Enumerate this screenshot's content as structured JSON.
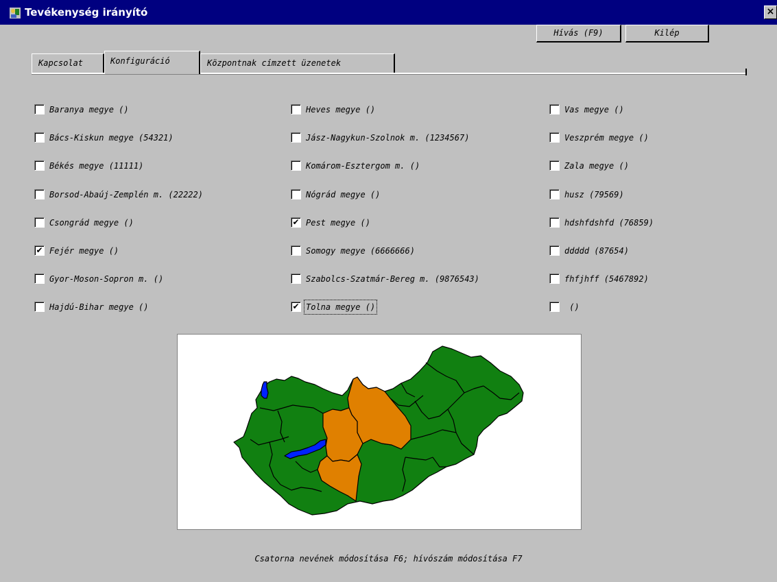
{
  "window": {
    "title": "Tevékenység irányító",
    "close_glyph": "×"
  },
  "buttons": {
    "call": "Hívás (F9)",
    "exit": "Kilép"
  },
  "tabs": [
    {
      "label": "Kapcsolat",
      "active": false
    },
    {
      "label": "Konfiguráció",
      "active": true
    },
    {
      "label": "Központnak címzett üzenetek",
      "active": false
    }
  ],
  "checkmark_glyph": "✔",
  "checkbox_columns": [
    [
      {
        "label": "Baranya megye ()",
        "checked": false
      },
      {
        "label": "Bács-Kiskun megye (54321)",
        "checked": false
      },
      {
        "label": "Békés megye (11111)",
        "checked": false
      },
      {
        "label": "Borsod-Abaúj-Zemplén m. (22222)",
        "checked": false
      },
      {
        "label": "Csongrád megye ()",
        "checked": false
      },
      {
        "label": "Fejér megye ()",
        "checked": true
      },
      {
        "label": "Gyor-Moson-Sopron m. ()",
        "checked": false
      },
      {
        "label": "Hajdú-Bihar megye ()",
        "checked": false
      }
    ],
    [
      {
        "label": "Heves megye ()",
        "checked": false
      },
      {
        "label": "Jász-Nagykun-Szolnok m. (1234567)",
        "checked": false
      },
      {
        "label": "Komárom-Esztergom m. ()",
        "checked": false
      },
      {
        "label": "Nógrád megye ()",
        "checked": false
      },
      {
        "label": "Pest megye ()",
        "checked": true
      },
      {
        "label": "Somogy megye (6666666)",
        "checked": false
      },
      {
        "label": "Szabolcs-Szatmár-Bereg m. (9876543)",
        "checked": false
      },
      {
        "label": "Tolna megye ()",
        "checked": true,
        "focused": true
      }
    ],
    [
      {
        "label": "Vas megye ()",
        "checked": false
      },
      {
        "label": "Veszprém megye ()",
        "checked": false
      },
      {
        "label": "Zala megye ()",
        "checked": false
      },
      {
        "label": "husz (79569)",
        "checked": false
      },
      {
        "label": "hdshfdshfd (76859)",
        "checked": false
      },
      {
        "label": "ddddd (87654)",
        "checked": false
      },
      {
        "label": "fhfjhff (5467892)",
        "checked": false
      },
      {
        "label": " ()",
        "checked": false
      }
    ]
  ],
  "map": {
    "selected_fill": "#e08000",
    "default_fill": "#118011",
    "water_fill": "#0022ff",
    "selected_counties": [
      "Fejér",
      "Pest",
      "Tolna"
    ]
  },
  "status": {
    "hint": "Csatorna nevének módosítása F6; hívószám módosítása F7"
  },
  "colors": {
    "titlebar": "#000080",
    "face": "#c0c0c0"
  }
}
